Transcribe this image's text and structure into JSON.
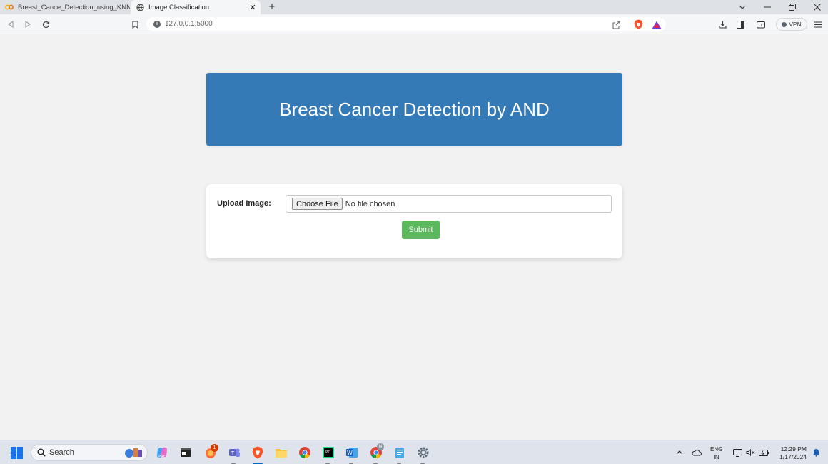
{
  "browser": {
    "tabs": [
      {
        "title": "Breast_Cance_Detection_using_KNN -",
        "icon": "colab-icon"
      },
      {
        "title": "Image Classification",
        "icon": "globe-icon",
        "close": "✕"
      }
    ],
    "address": "127.0.0.1:5000",
    "vpn_label": "VPN"
  },
  "page": {
    "header_title": "Breast Cancer Detection by AND",
    "form": {
      "upload_label": "Upload Image:",
      "choose_button": "Choose File",
      "file_status": "No file chosen",
      "submit_label": "Submit"
    }
  },
  "taskbar": {
    "search_label": "Search",
    "notification_badge": "1",
    "chrome_badge": "N",
    "language_line1": "ENG",
    "language_line2": "IN",
    "time": "12:29 PM",
    "date": "1/17/2024"
  },
  "colors": {
    "header_bg": "#337ab7",
    "submit_bg": "#5cb85c",
    "page_bg": "#f2f2f2"
  }
}
